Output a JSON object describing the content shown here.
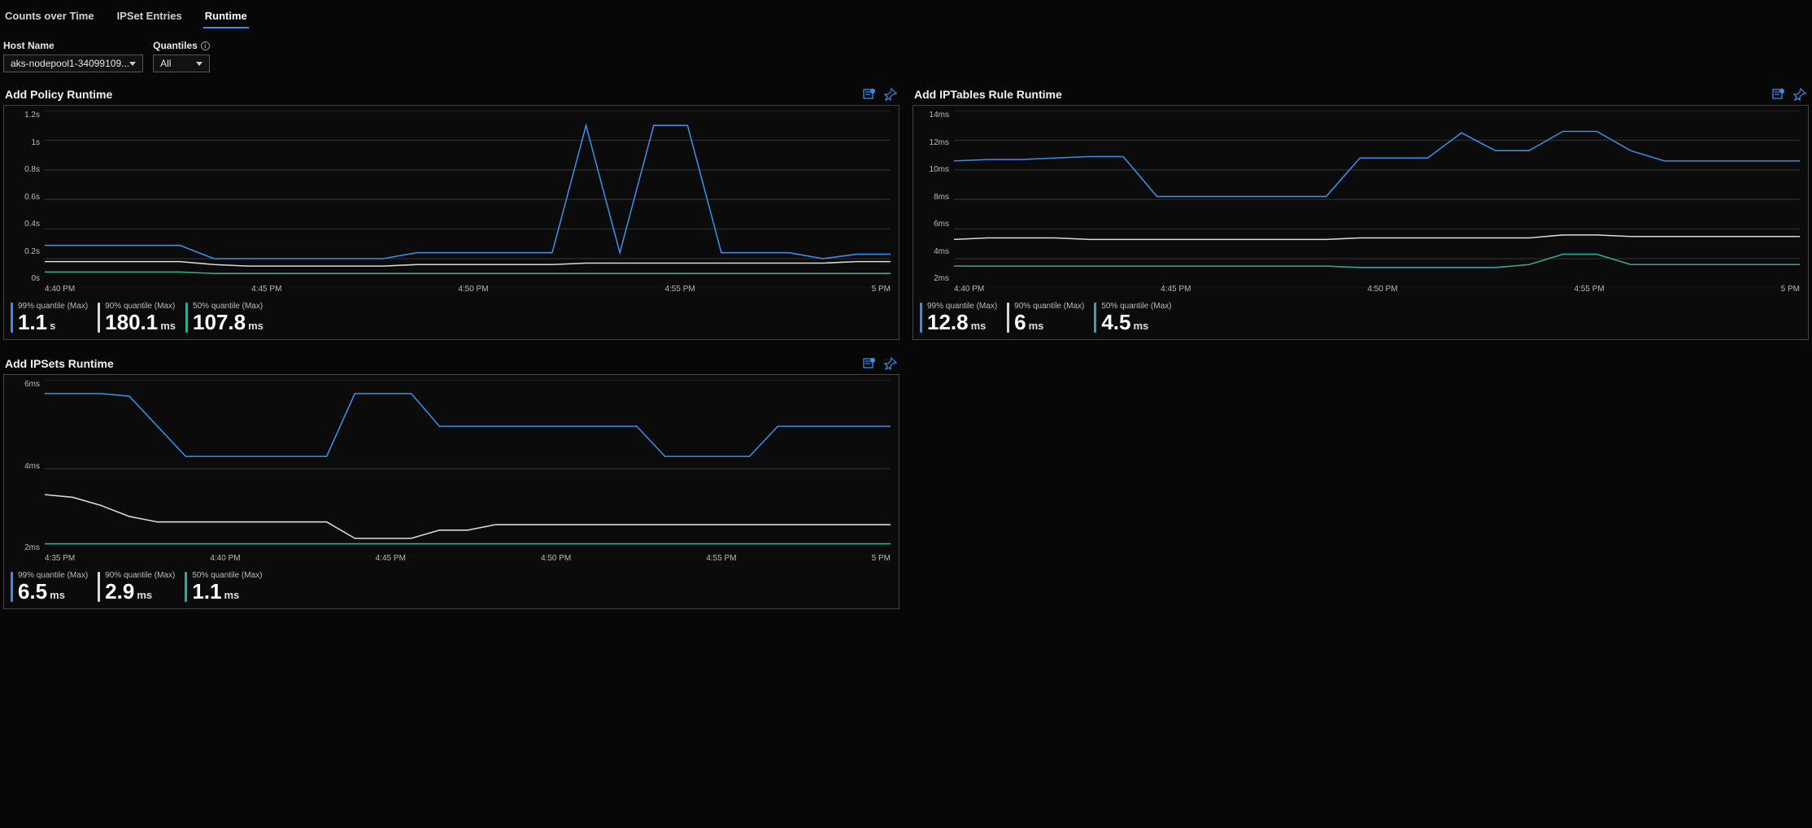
{
  "tabs": [
    {
      "label": "Counts over Time",
      "active": false
    },
    {
      "label": "IPSet Entries",
      "active": false
    },
    {
      "label": "Runtime",
      "active": true
    }
  ],
  "filters": {
    "hostname": {
      "label": "Host Name",
      "value": "aks-nodepool1-34099109..."
    },
    "quantiles": {
      "label": "Quantiles",
      "value": "All"
    }
  },
  "colors": {
    "q99": "#3a8ee6",
    "q90": "#d9d9d9",
    "q50": "#2fa99a"
  },
  "metric_label_template": {
    "q99": "99% quantile (Max)",
    "q90": "90% quantile (Max)",
    "q50": "50% quantile (Max)"
  },
  "panels": [
    {
      "id": "add_policy",
      "title": "Add Policy Runtime",
      "metrics": {
        "q99": {
          "value": "1.1",
          "unit": "s"
        },
        "q90": {
          "value": "180.1",
          "unit": "ms"
        },
        "q50": {
          "value": "107.8",
          "unit": "ms"
        }
      }
    },
    {
      "id": "add_iptables",
      "title": "Add IPTables Rule Runtime",
      "metrics": {
        "q99": {
          "value": "12.8",
          "unit": "ms"
        },
        "q90": {
          "value": "6",
          "unit": "ms"
        },
        "q50": {
          "value": "4.5",
          "unit": "ms"
        }
      }
    },
    {
      "id": "add_ipsets",
      "title": "Add IPSets Runtime",
      "metrics": {
        "q99": {
          "value": "6.5",
          "unit": "ms"
        },
        "q90": {
          "value": "2.9",
          "unit": "ms"
        },
        "q50": {
          "value": "1.1",
          "unit": "ms"
        }
      }
    }
  ],
  "chart_data": [
    {
      "id": "add_policy",
      "type": "line",
      "title": "Add Policy Runtime",
      "xlabel": "",
      "ylabel": "",
      "yticks": [
        "1.2s",
        "1s",
        "0.8s",
        "0.6s",
        "0.4s",
        "0.2s",
        "0s"
      ],
      "ylim": [
        0,
        1.2
      ],
      "x": [
        "4:40 PM",
        "4:45 PM",
        "4:50 PM",
        "4:55 PM",
        "5 PM"
      ],
      "series": [
        {
          "name": "99% quantile",
          "color_key": "q99",
          "values": [
            0.29,
            0.29,
            0.29,
            0.29,
            0.29,
            0.2,
            0.2,
            0.2,
            0.2,
            0.2,
            0.2,
            0.24,
            0.24,
            0.24,
            0.24,
            0.24,
            1.1,
            0.24,
            1.1,
            1.1,
            0.24,
            0.24,
            0.24,
            0.2,
            0.23,
            0.23
          ]
        },
        {
          "name": "90% quantile",
          "color_key": "q90",
          "values": [
            0.18,
            0.18,
            0.18,
            0.18,
            0.18,
            0.16,
            0.15,
            0.15,
            0.15,
            0.15,
            0.15,
            0.16,
            0.16,
            0.16,
            0.16,
            0.16,
            0.17,
            0.17,
            0.17,
            0.17,
            0.17,
            0.17,
            0.17,
            0.17,
            0.18,
            0.18
          ]
        },
        {
          "name": "50% quantile",
          "color_key": "q50",
          "values": [
            0.11,
            0.11,
            0.11,
            0.11,
            0.11,
            0.1,
            0.1,
            0.1,
            0.1,
            0.1,
            0.1,
            0.1,
            0.1,
            0.1,
            0.1,
            0.1,
            0.1,
            0.1,
            0.1,
            0.1,
            0.1,
            0.1,
            0.1,
            0.1,
            0.1,
            0.1
          ]
        }
      ]
    },
    {
      "id": "add_iptables",
      "type": "line",
      "title": "Add IPTables Rule Runtime",
      "xlabel": "",
      "ylabel": "",
      "yticks": [
        "14ms",
        "12ms",
        "10ms",
        "8ms",
        "6ms",
        "4ms",
        "2ms"
      ],
      "ylim": [
        2,
        14
      ],
      "x": [
        "4:40 PM",
        "4:45 PM",
        "4:50 PM",
        "4:55 PM",
        "5 PM"
      ],
      "series": [
        {
          "name": "99% quantile",
          "color_key": "q99",
          "values": [
            10.6,
            10.7,
            10.7,
            10.8,
            10.9,
            10.9,
            8.2,
            8.2,
            8.2,
            8.2,
            8.2,
            8.2,
            10.8,
            10.8,
            10.8,
            12.5,
            11.3,
            11.3,
            12.6,
            12.6,
            11.3,
            10.6,
            10.6,
            10.6,
            10.6,
            10.6
          ]
        },
        {
          "name": "90% quantile",
          "color_key": "q90",
          "values": [
            5.3,
            5.4,
            5.4,
            5.4,
            5.3,
            5.3,
            5.3,
            5.3,
            5.3,
            5.3,
            5.3,
            5.3,
            5.4,
            5.4,
            5.4,
            5.4,
            5.4,
            5.4,
            5.6,
            5.6,
            5.5,
            5.5,
            5.5,
            5.5,
            5.5,
            5.5
          ]
        },
        {
          "name": "50% quantile",
          "color_key": "q50",
          "values": [
            3.5,
            3.5,
            3.5,
            3.5,
            3.5,
            3.5,
            3.5,
            3.5,
            3.5,
            3.5,
            3.5,
            3.5,
            3.4,
            3.4,
            3.4,
            3.4,
            3.4,
            3.6,
            4.3,
            4.3,
            3.6,
            3.6,
            3.6,
            3.6,
            3.6,
            3.6
          ]
        }
      ]
    },
    {
      "id": "add_ipsets",
      "type": "line",
      "title": "Add IPSets Runtime",
      "xlabel": "",
      "ylabel": "",
      "yticks": [
        "6ms",
        "4ms",
        "2ms"
      ],
      "ylim": [
        0.5,
        7
      ],
      "x": [
        "4:35 PM",
        "4:40 PM",
        "4:45 PM",
        "4:50 PM",
        "4:55 PM",
        "5 PM"
      ],
      "series": [
        {
          "name": "99% quantile",
          "color_key": "q99",
          "values": [
            6.5,
            6.5,
            6.5,
            6.4,
            5.3,
            4.2,
            4.2,
            4.2,
            4.2,
            4.2,
            4.2,
            6.5,
            6.5,
            6.5,
            5.3,
            5.3,
            5.3,
            5.3,
            5.3,
            5.3,
            5.3,
            5.3,
            4.2,
            4.2,
            4.2,
            4.2,
            5.3,
            5.3,
            5.3,
            5.3,
            5.3
          ]
        },
        {
          "name": "90% quantile",
          "color_key": "q90",
          "values": [
            2.8,
            2.7,
            2.4,
            2.0,
            1.8,
            1.8,
            1.8,
            1.8,
            1.8,
            1.8,
            1.8,
            1.2,
            1.2,
            1.2,
            1.5,
            1.5,
            1.7,
            1.7,
            1.7,
            1.7,
            1.7,
            1.7,
            1.7,
            1.7,
            1.7,
            1.7,
            1.7,
            1.7,
            1.7,
            1.7,
            1.7
          ]
        },
        {
          "name": "50% quantile",
          "color_key": "q50",
          "values": [
            1.0,
            1.0,
            1.0,
            1.0,
            1.0,
            1.0,
            1.0,
            1.0,
            1.0,
            1.0,
            1.0,
            1.0,
            1.0,
            1.0,
            1.0,
            1.0,
            1.0,
            1.0,
            1.0,
            1.0,
            1.0,
            1.0,
            1.0,
            1.0,
            1.0,
            1.0,
            1.0,
            1.0,
            1.0,
            1.0,
            1.0
          ]
        }
      ]
    }
  ]
}
